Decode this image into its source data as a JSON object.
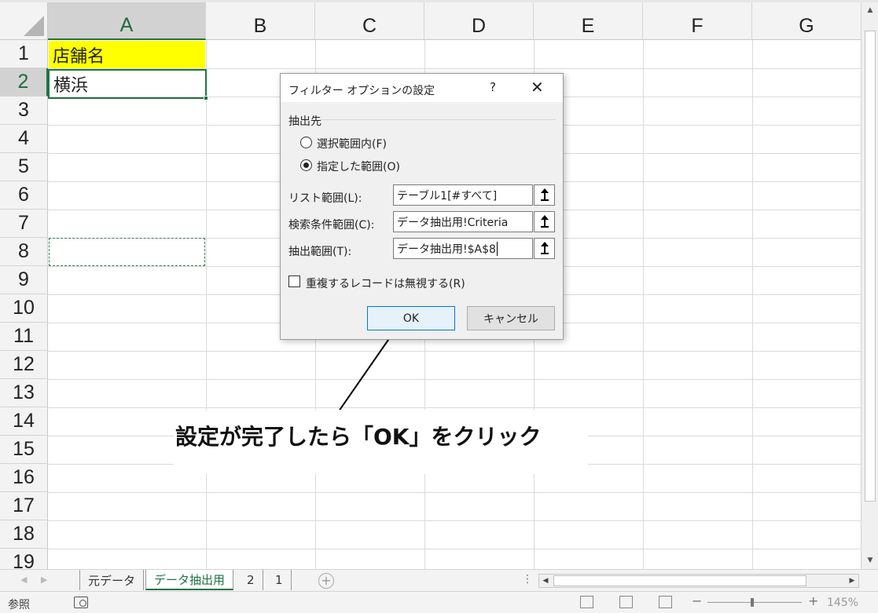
{
  "columns": [
    "A",
    "B",
    "C",
    "D",
    "E",
    "F",
    "G"
  ],
  "rows": [
    "1",
    "2",
    "3",
    "4",
    "5",
    "6",
    "7",
    "8",
    "9",
    "10",
    "11",
    "12",
    "13",
    "14",
    "15",
    "16",
    "17",
    "18",
    "19"
  ],
  "cells": {
    "A1": "店舗名",
    "A2": "横浜"
  },
  "colors": {
    "header_highlight": "#ffff00",
    "excel_green": "#217346",
    "ok_border": "#0078d7"
  },
  "dialog": {
    "title": "フィルター オプションの設定",
    "help": "?",
    "close": "✕",
    "group_label": "抽出先",
    "radio_in_place": "選択範囲内(F)",
    "radio_copy": "指定した範囲(O)",
    "radio_selected": "copy",
    "list_range_label": "リスト範囲(L):",
    "list_range_value": "テーブル1[#すべて]",
    "criteria_label": "検索条件範囲(C):",
    "criteria_value": "データ抽出用!Criteria",
    "copy_to_label": "抽出範囲(T):",
    "copy_to_value": "データ抽出用!$A$8",
    "unique_label": "重複するレコードは無視する(R)",
    "unique_checked": false,
    "ok": "OK",
    "cancel": "キャンセル"
  },
  "annotation": "設定が完了したら「OK」をクリック",
  "sheet_tabs": [
    "元データ",
    "データ抽出用",
    "2",
    "1"
  ],
  "active_tab": "データ抽出用",
  "status": {
    "mode": "参照",
    "zoom": "145%"
  },
  "icons": {
    "pick_range": "collapse-dialog-icon",
    "add_sheet": "plus-icon",
    "macro": "macro-record-icon"
  }
}
